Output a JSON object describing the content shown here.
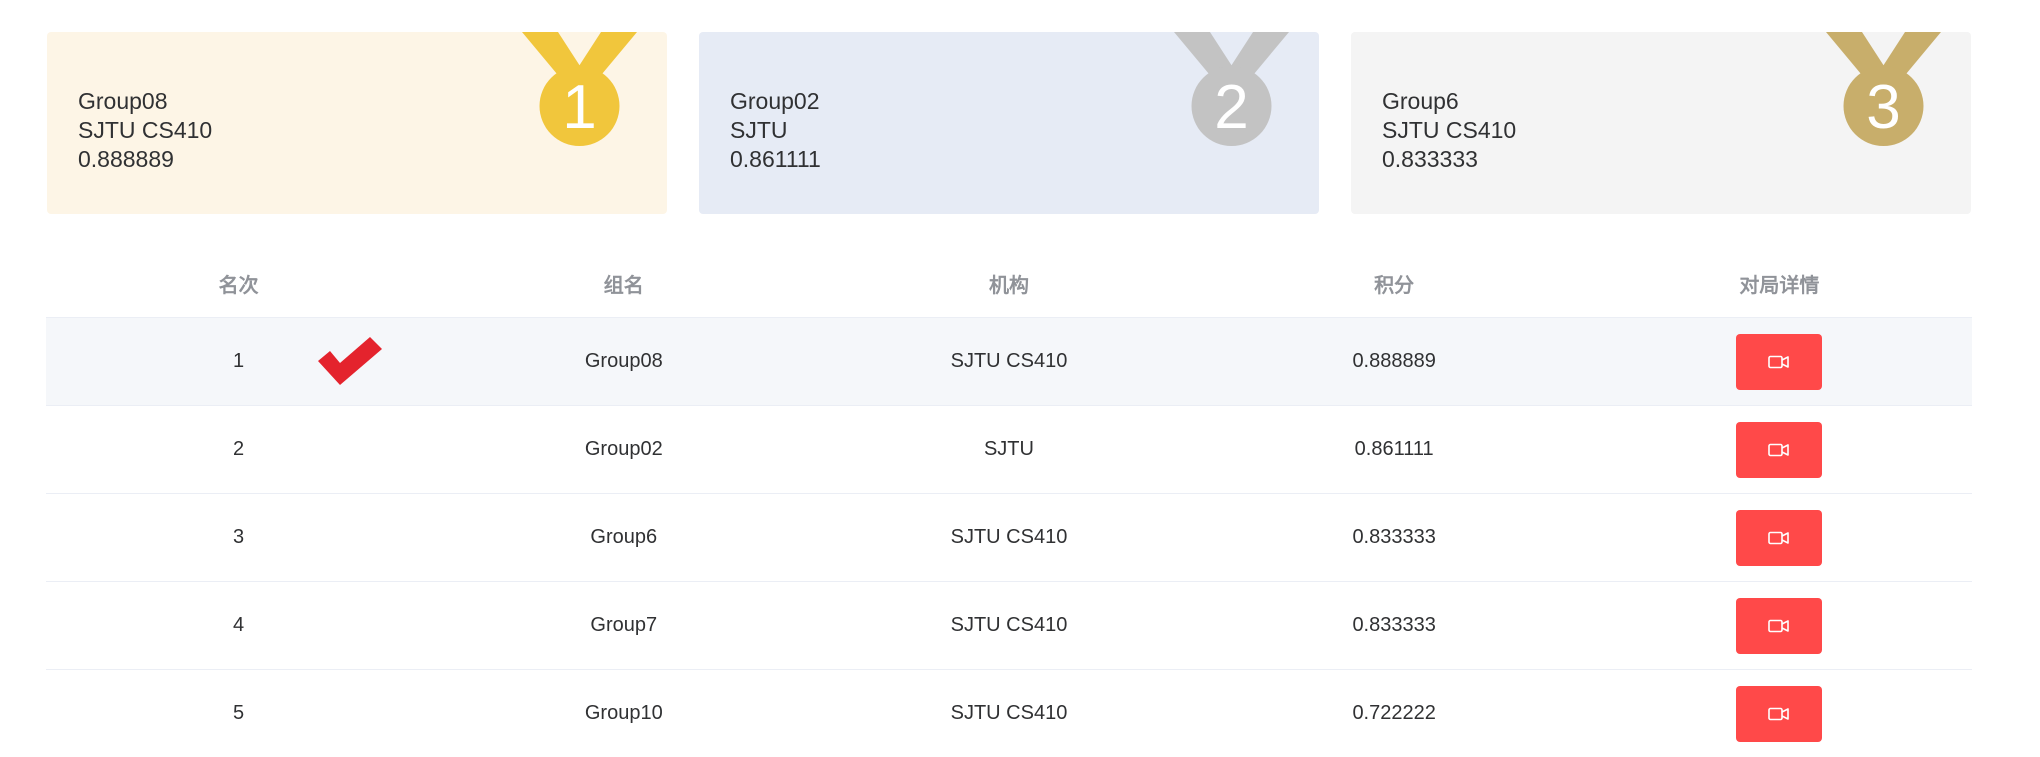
{
  "podium": [
    {
      "name": "Group08",
      "org": "SJTU CS410",
      "score": "0.888889",
      "medal_number": "1",
      "medal_color": "#f1c63c",
      "ribbon_color": "#f1c63c",
      "bg": "#fdf5e6"
    },
    {
      "name": "Group02",
      "org": "SJTU",
      "score": "0.861111",
      "medal_number": "2",
      "medal_color": "#c3c3c3",
      "ribbon_color": "#c3c3c3",
      "bg": "#e6ebf5"
    },
    {
      "name": "Group6",
      "org": "SJTU CS410",
      "score": "0.833333",
      "medal_number": "3",
      "medal_color": "#c8ae6b",
      "ribbon_color": "#c8ae6b",
      "bg": "#f4f4f4"
    }
  ],
  "table": {
    "headers": {
      "rank": "名次",
      "group": "组名",
      "org": "机构",
      "score": "积分",
      "details": "对局详情"
    },
    "rows": [
      {
        "rank": "1",
        "group": "Group08",
        "org": "SJTU CS410",
        "score": "0.888889",
        "highlighted": true,
        "checked": true
      },
      {
        "rank": "2",
        "group": "Group02",
        "org": "SJTU",
        "score": "0.861111",
        "highlighted": false,
        "checked": false
      },
      {
        "rank": "3",
        "group": "Group6",
        "org": "SJTU CS410",
        "score": "0.833333",
        "highlighted": false,
        "checked": false
      },
      {
        "rank": "4",
        "group": "Group7",
        "org": "SJTU CS410",
        "score": "0.833333",
        "highlighted": false,
        "checked": false
      },
      {
        "rank": "5",
        "group": "Group10",
        "org": "SJTU CS410",
        "score": "0.722222",
        "highlighted": false,
        "checked": false
      }
    ],
    "details_icon": "video-camera-icon",
    "button_color": "#ff4949",
    "check_icon": "checkmark-icon",
    "check_color": "#e4232d"
  }
}
